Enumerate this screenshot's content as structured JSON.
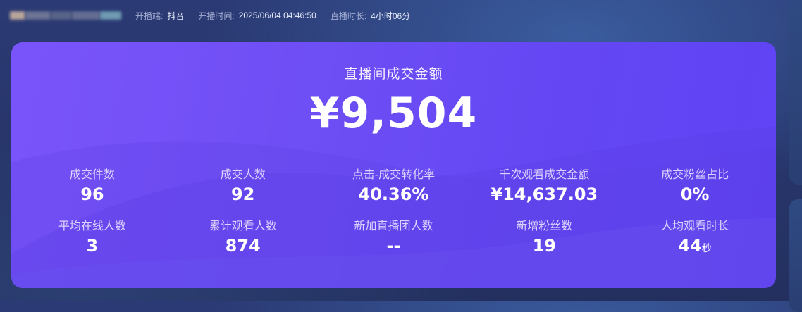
{
  "header": {
    "platform_label": "开播端:",
    "platform_value": "抖音",
    "start_time_label": "开播时间:",
    "start_time_value": "2025/06/04 04:46:50",
    "duration_label": "直播时长:",
    "duration_value": "4小时06分"
  },
  "summary": {
    "title": "直播间成交金额",
    "amount": "¥9,504"
  },
  "stats": [
    {
      "label": "成交件数",
      "value": "96",
      "unit": ""
    },
    {
      "label": "成交人数",
      "value": "92",
      "unit": ""
    },
    {
      "label": "点击-成交转化率",
      "value": "40.36%",
      "unit": ""
    },
    {
      "label": "千次观看成交金额",
      "value": "¥14,637.03",
      "unit": ""
    },
    {
      "label": "成交粉丝占比",
      "value": "0%",
      "unit": ""
    },
    {
      "label": "平均在线人数",
      "value": "3",
      "unit": ""
    },
    {
      "label": "累计观看人数",
      "value": "874",
      "unit": ""
    },
    {
      "label": "新加直播团人数",
      "value": "--",
      "unit": ""
    },
    {
      "label": "新增粉丝数",
      "value": "19",
      "unit": ""
    },
    {
      "label": "人均观看时长",
      "value": "44",
      "unit": "秒"
    }
  ],
  "colors": {
    "card_gradient_start": "#7a54fb",
    "card_gradient_end": "#5f43f5",
    "page_background": "#27356a"
  }
}
